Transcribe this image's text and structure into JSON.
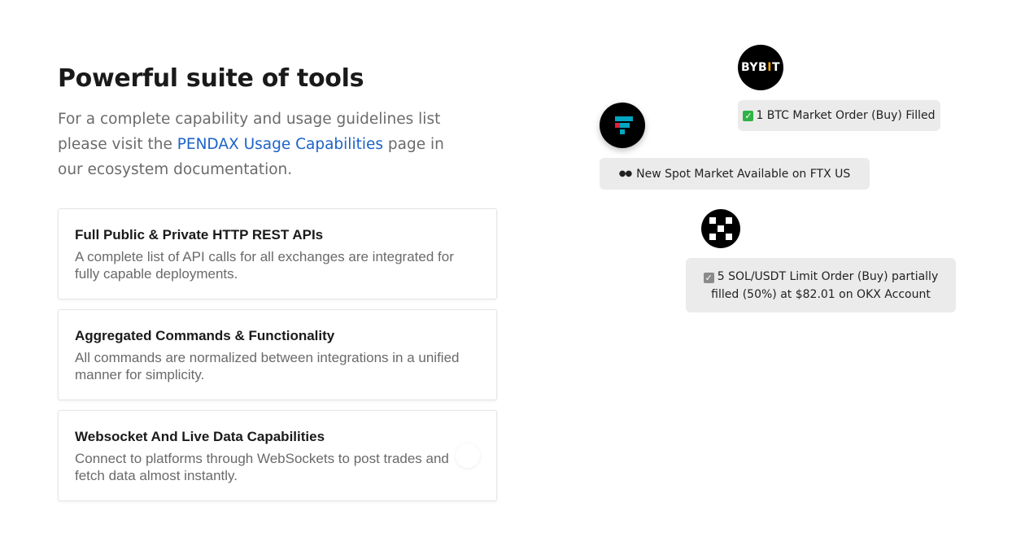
{
  "header": {
    "title": "Powerful suite of tools",
    "desc_before": "For a complete capability and usage guidelines list please visit the ",
    "desc_link": "PENDAX Usage Capabilities",
    "desc_after": " page in our ecosystem documentation."
  },
  "cards": [
    {
      "title": "Full Public & Private HTTP REST APIs",
      "text": "A complete list of API calls for all exchanges are integrated for fully capable deployments."
    },
    {
      "title": "Aggregated Commands & Functionality",
      "text": "All commands are normalized between integrations in a unified manner for simplicity."
    },
    {
      "title": "Websocket And Live Data Capabilities",
      "text": "Connect to platforms through WebSockets to post trades and fetch data almost instantly."
    }
  ],
  "visual": {
    "bybit_logo": {
      "text_1": "BYB",
      "text_accent": "I",
      "text_2": "T",
      "accent_color": "#f7a600"
    },
    "bybit_message": "1 BTC Market Order (Buy) Filled",
    "ftx_message": "New Spot Market Available on FTX US",
    "okx_message_line1": "5 SOL/USDT Limit Order (Buy) partially",
    "okx_message_line2": "filled (50%) at $82.01 on OKX Account",
    "icons": {
      "ftx": "ftx-logo-icon",
      "okx": "okx-logo-icon",
      "check_green": "check-mark-green-icon",
      "check_gray": "check-box-gray-icon",
      "eyes": "eyes-emoji-icon"
    },
    "colors": {
      "link": "#1c63c9",
      "ftx_cyan": "#02a6c2",
      "ftx_red": "#e31d3a",
      "check_green": "#2fb344"
    }
  }
}
